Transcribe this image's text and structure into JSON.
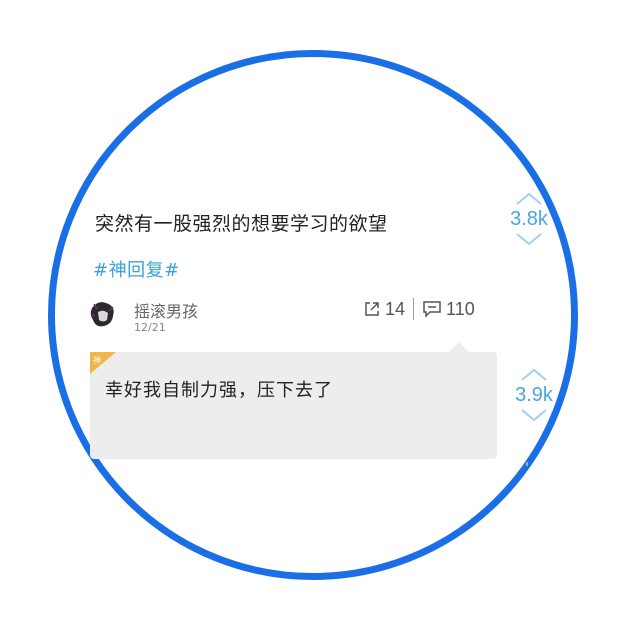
{
  "post": {
    "text": "突然有一股强烈的想要学习的欲望",
    "hashtag": "#神回复#",
    "score": "3.8k"
  },
  "author": {
    "username": "摇滚男孩",
    "date": "12/21"
  },
  "stats": {
    "shares": "14",
    "comments": "110"
  },
  "reply": {
    "badge_char": "神",
    "text": "幸好我自制力强，压下去了",
    "score": "3.9k"
  },
  "colors": {
    "ring": "#1a6fe6",
    "accent": "#3aa2dc",
    "badge": "#f0b64a"
  },
  "icons": {
    "upvote": "chevron-up-icon",
    "downvote": "chevron-down-icon",
    "share": "share-icon",
    "comment": "comment-icon"
  }
}
